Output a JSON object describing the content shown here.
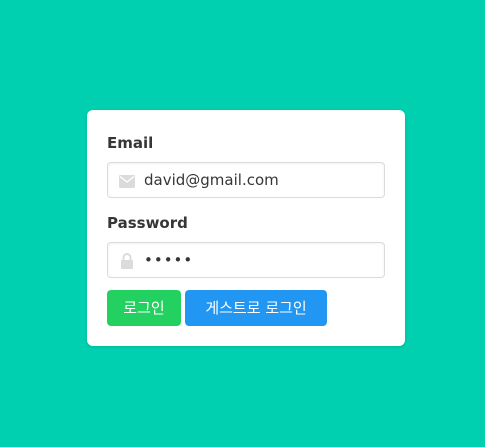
{
  "colors": {
    "background": "#00cfb0",
    "card": "#ffffff",
    "login_button": "#23d160",
    "guest_button": "#2196f3",
    "icon": "#dbdbdb"
  },
  "form": {
    "email_label": "Email",
    "email_value": "david@gmail.com",
    "email_icon": "envelope-icon",
    "password_label": "Password",
    "password_value": "•••••",
    "password_icon": "lock-icon",
    "login_button": "로그인",
    "guest_login_button": "게스트로 로그인"
  }
}
